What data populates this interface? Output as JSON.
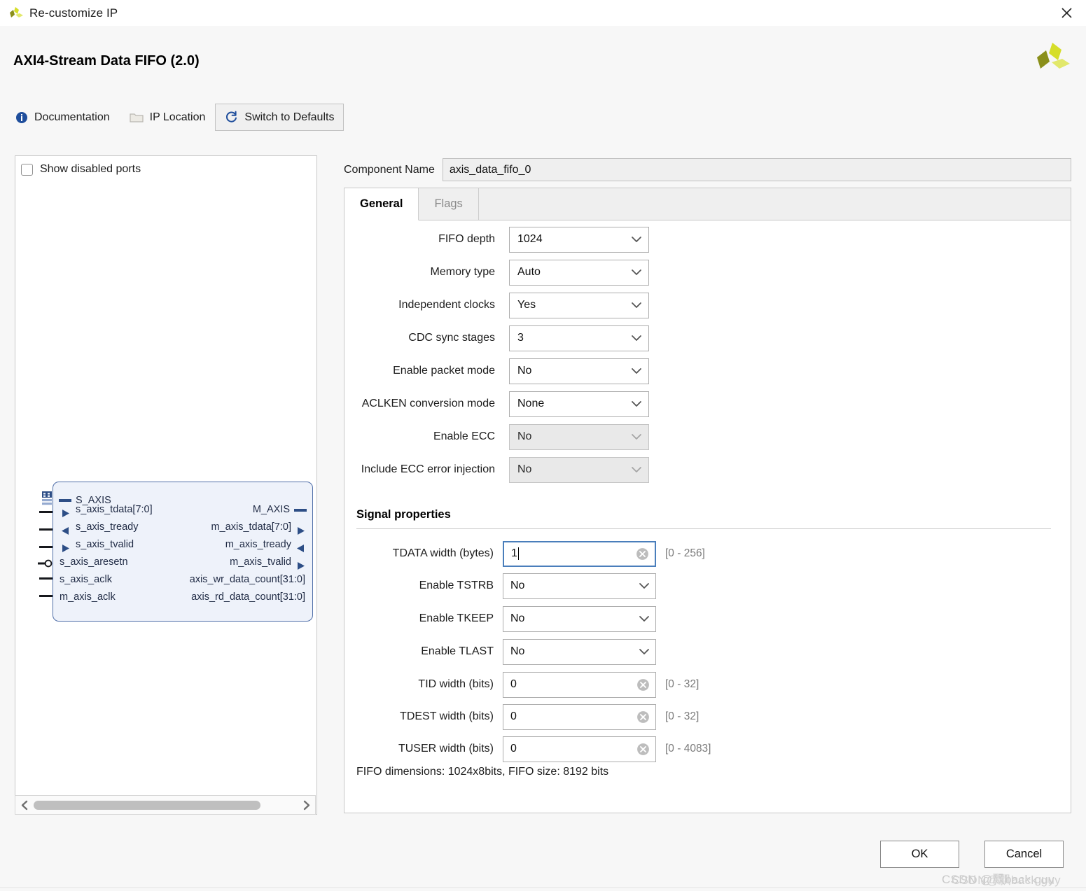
{
  "window": {
    "title": "Re-customize IP",
    "close_icon": "close-icon",
    "logo_icon": "xilinx-logo-icon"
  },
  "header": {
    "ip_title": "AXI4-Stream Data FIFO (2.0)",
    "logo_icon": "xilinx-logo-icon"
  },
  "toolbar": {
    "documentation": "Documentation",
    "documentation_icon": "info-icon",
    "ip_location": "IP Location",
    "ip_location_icon": "folder-icon",
    "switch_to_defaults": "Switch to Defaults",
    "switch_icon": "refresh-icon"
  },
  "left_panel": {
    "show_disabled_ports": "Show disabled ports",
    "show_disabled_ports_checked": false,
    "diagram": {
      "bus_icon": "bus-connector-icon",
      "left_ports": [
        {
          "name": "S_AXIS",
          "marker": "bus-dash",
          "stub": "bus"
        },
        {
          "name": "s_axis_tdata[7:0]",
          "marker": "arrow-right",
          "stub": "pin"
        },
        {
          "name": "s_axis_tready",
          "marker": "arrow-left",
          "stub": "pin"
        },
        {
          "name": "s_axis_tvalid",
          "marker": "arrow-right",
          "stub": "pin"
        },
        {
          "name": "s_axis_aresetn",
          "marker": "none",
          "stub": "bubble"
        },
        {
          "name": "s_axis_aclk",
          "marker": "none",
          "stub": "pin"
        },
        {
          "name": "m_axis_aclk",
          "marker": "none",
          "stub": "pin"
        }
      ],
      "right_ports": [
        {
          "name": "M_AXIS",
          "marker": "bus-dash"
        },
        {
          "name": "m_axis_tdata[7:0]",
          "marker": "arrow-right"
        },
        {
          "name": "m_axis_tready",
          "marker": "arrow-left"
        },
        {
          "name": "m_axis_tvalid",
          "marker": "arrow-right"
        },
        {
          "name": "axis_wr_data_count[31:0]",
          "marker": "none"
        },
        {
          "name": "axis_rd_data_count[31:0]",
          "marker": "none"
        }
      ]
    },
    "scrollbar": {
      "left_arrow_icon": "chevron-left-icon",
      "right_arrow_icon": "chevron-right-icon"
    }
  },
  "component": {
    "label": "Component Name",
    "value": "axis_data_fifo_0"
  },
  "tabs": [
    {
      "label": "General",
      "active": true
    },
    {
      "label": "Flags",
      "active": false
    }
  ],
  "general": {
    "rows": [
      {
        "label": "FIFO depth",
        "value": "1024",
        "disabled": false,
        "indent": false
      },
      {
        "label": "Memory type",
        "value": "Auto",
        "disabled": false,
        "indent": false
      },
      {
        "label": "Independent clocks",
        "value": "Yes",
        "disabled": false,
        "indent": false
      },
      {
        "label": "CDC sync stages",
        "value": "3",
        "disabled": false,
        "indent": true
      },
      {
        "label": "Enable packet mode",
        "value": "No",
        "disabled": false,
        "indent": false
      },
      {
        "label": "ACLKEN conversion mode",
        "value": "None",
        "disabled": false,
        "indent": false
      },
      {
        "label": "Enable ECC",
        "value": "No",
        "disabled": true,
        "indent": false
      },
      {
        "label": "Include ECC error injection",
        "value": "No",
        "disabled": true,
        "indent": true
      }
    ]
  },
  "signal_properties": {
    "title": "Signal properties",
    "rows": [
      {
        "label": "TDATA width (bytes)",
        "value": "1",
        "type": "text",
        "range": "[0 - 256]",
        "focused": true
      },
      {
        "label": "Enable TSTRB",
        "value": "No",
        "type": "combo",
        "range": "",
        "focused": false
      },
      {
        "label": "Enable TKEEP",
        "value": "No",
        "type": "combo",
        "range": "",
        "focused": false
      },
      {
        "label": "Enable TLAST",
        "value": "No",
        "type": "combo",
        "range": "",
        "focused": false
      },
      {
        "label": "TID width (bits)",
        "value": "0",
        "type": "text",
        "range": "[0 - 32]",
        "focused": false
      },
      {
        "label": "TDEST width (bits)",
        "value": "0",
        "type": "text",
        "range": "[0 - 32]",
        "focused": false
      },
      {
        "label": "TUSER width (bits)",
        "value": "0",
        "type": "text",
        "range": "[0 - 4083]",
        "focused": false
      }
    ],
    "summary": "FIFO dimensions: 1024x8bits, FIFO size: 8192 bits"
  },
  "footer": {
    "ok": "OK",
    "cancel": "Cancel",
    "watermark": "CSDN @飘back guy",
    "watermark_overlay": "CSDN@飘back guy"
  },
  "colors": {
    "accent_blue": "#4a7ebb",
    "logo_olive": "#8a8f1a",
    "logo_yellow": "#d6de2a",
    "block_border": "#4f6ea8"
  }
}
